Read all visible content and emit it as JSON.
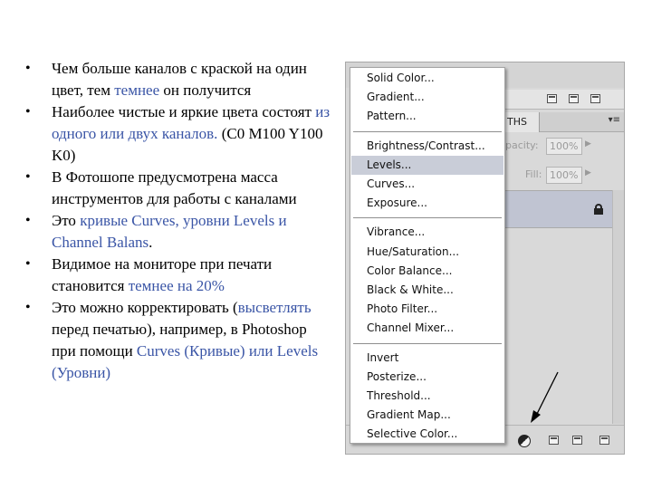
{
  "bullets": [
    {
      "parts": [
        {
          "text": "Чем больше каналов с краской на один цвет, тем ",
          "hl": false
        },
        {
          "text": "темнее",
          "hl": true
        },
        {
          "text": " он получится",
          "hl": false
        }
      ]
    },
    {
      "parts": [
        {
          "text": "Наиболее чистые и яркие цвета состоят ",
          "hl": false
        },
        {
          "text": "из одного или двух каналов.",
          "hl": true
        },
        {
          "text": " (C0 M100 Y100 K0)",
          "hl": false
        }
      ]
    },
    {
      "parts": [
        {
          "text": "В Фотошопе предусмотрена масса инструментов для работы с каналами",
          "hl": false
        }
      ]
    },
    {
      "parts": [
        {
          "text": "Это ",
          "hl": false
        },
        {
          "text": "кривые Curves, уровни Levels и Channel Balans",
          "hl": true
        },
        {
          "text": ".",
          "hl": false
        }
      ]
    },
    {
      "parts": [
        {
          "text": "Видимое на мониторе при печати становится ",
          "hl": false
        },
        {
          "text": "темнее на 20%",
          "hl": true
        }
      ]
    },
    {
      "parts": [
        {
          "text": "Это можно корректировать (",
          "hl": false
        },
        {
          "text": "высветлять",
          "hl": true
        },
        {
          "text": " перед печатью), например, в Photoshop при помощи ",
          "hl": false
        },
        {
          "text": "Curves (Кривые) или Levels (Уровни)",
          "hl": true
        }
      ]
    }
  ],
  "panel": {
    "tab_label": "THS",
    "menu_glyph": "▾≡",
    "opacity_label": "pacity:",
    "opacity_value": "100%",
    "fill_label": "Fill:",
    "fill_value": "100%"
  },
  "menu": {
    "groups": [
      [
        "Solid Color...",
        "Gradient...",
        "Pattern..."
      ],
      [
        "Brightness/Contrast...",
        "Levels...",
        "Curves...",
        "Exposure..."
      ],
      [
        "Vibrance...",
        "Hue/Saturation...",
        "Color Balance...",
        "Black & White...",
        "Photo Filter...",
        "Channel Mixer..."
      ],
      [
        "Invert",
        "Posterize...",
        "Threshold...",
        "Gradient Map...",
        "Selective Color..."
      ]
    ],
    "selected": "Levels..."
  },
  "colors": {
    "highlight_text": "#3a55a6",
    "menu_selected": "#c9cdd8"
  }
}
